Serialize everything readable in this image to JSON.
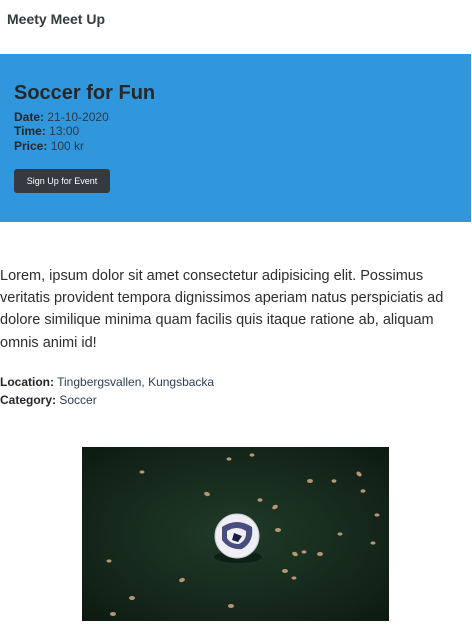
{
  "navbar": {
    "brand": "Meety Meet Up"
  },
  "event": {
    "title": "Soccer for Fun",
    "date_label": "Date:",
    "date_value": "21-10-2020",
    "time_label": "Time:",
    "time_value": "13:00",
    "price_label": "Price:",
    "price_value": "100 kr",
    "signup_label": "Sign Up for Event",
    "description": "Lorem, ipsum dolor sit amet consectetur adipisicing elit. Possimus veritatis provident tempora dignissimos aperiam natus perspiciatis ad dolore similique minima quam facilis quis itaque ratione ab, aliquam omnis animi id!",
    "location_label": "Location:",
    "location_value": "Tingbergsvallen, Kungsbacka",
    "category_label": "Category:",
    "category_value": "Soccer"
  },
  "image": {
    "subject": "soccer-ball-on-grass"
  },
  "colors": {
    "hero_bg": "#3197dc",
    "button_bg": "#343a40",
    "grass": "#1a3321"
  }
}
